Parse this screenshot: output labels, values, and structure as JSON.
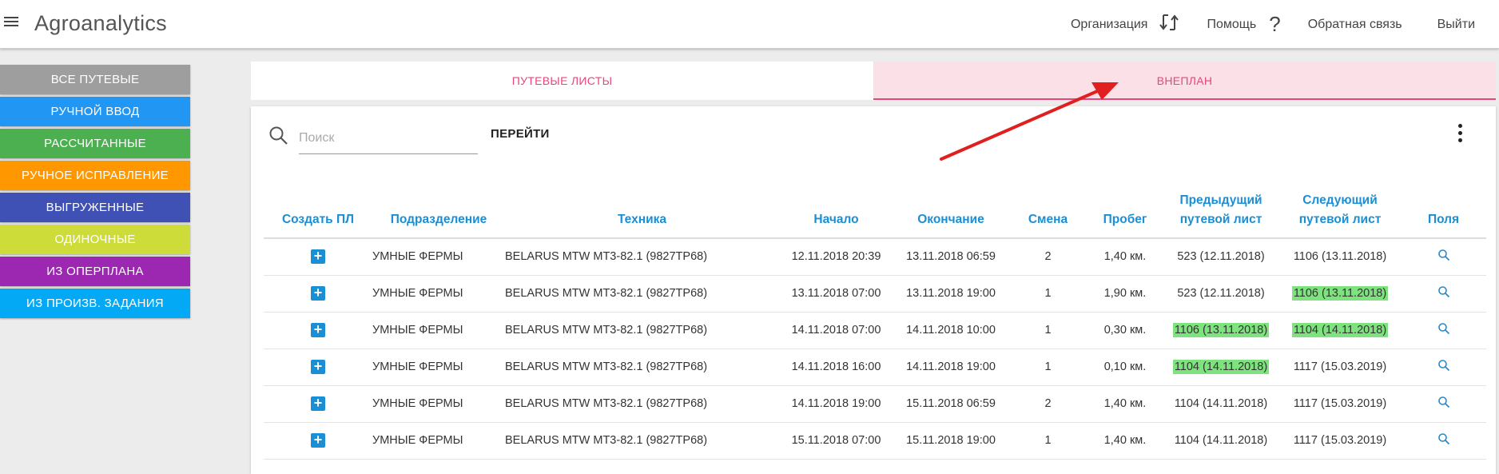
{
  "header": {
    "title": "Agroanalytics",
    "nav": {
      "organization": "Организация",
      "help": "Помощь",
      "feedback": "Обратная связь",
      "logout": "Выйти"
    }
  },
  "sidebar": {
    "items": [
      {
        "label": "ВСЕ ПУТЕВЫЕ",
        "color": "#9e9e9e"
      },
      {
        "label": "РУЧНОЙ ВВОД",
        "color": "#2196f3"
      },
      {
        "label": "РАССЧИТАННЫЕ",
        "color": "#4caf50"
      },
      {
        "label": "РУЧНОЕ ИСПРАВЛЕНИЕ",
        "color": "#ff9800"
      },
      {
        "label": "ВЫГРУЖЕННЫЕ",
        "color": "#3f51b5"
      },
      {
        "label": "ОДИНОЧНЫЕ",
        "color": "#cddc39"
      },
      {
        "label": "ИЗ ОПЕРПЛАНА",
        "color": "#9c27b0"
      },
      {
        "label": "ИЗ ПРОИЗВ. ЗАДАНИЯ",
        "color": "#03a9f4"
      }
    ]
  },
  "tabs": [
    {
      "label": "ПУТЕВЫЕ ЛИСТЫ",
      "active": false
    },
    {
      "label": "ВНЕПЛАН",
      "active": true
    }
  ],
  "search": {
    "placeholder": "Поиск",
    "go_label": "ПЕРЕЙТИ"
  },
  "table": {
    "headers": {
      "create": "Создать ПЛ",
      "division": "Подразделение",
      "vehicle": "Техника",
      "start": "Начало",
      "end": "Окончание",
      "shift": "Смена",
      "mileage": "Пробег",
      "prev_1": "Предыдущий",
      "prev_2": "путевой лист",
      "next_1": "Следующий",
      "next_2": "путевой лист",
      "fields": "Поля"
    },
    "rows": [
      {
        "division": "УМНЫЕ ФЕРМЫ",
        "vehicle": "BELARUS MTW MT3-82.1 (9827TP68)",
        "start": "12.11.2018 20:39",
        "end": "13.11.2018 06:59",
        "shift": "2",
        "mileage": "1,40 км.",
        "prev": "523 (12.11.2018)",
        "next": "1106 (13.11.2018)"
      },
      {
        "division": "УМНЫЕ ФЕРМЫ",
        "vehicle": "BELARUS MTW MT3-82.1 (9827TP68)",
        "start": "13.11.2018 07:00",
        "end": "13.11.2018 19:00",
        "shift": "1",
        "mileage": "1,90 км.",
        "prev": "523 (12.11.2018)",
        "next": "1106 (13.11.2018)"
      },
      {
        "division": "УМНЫЕ ФЕРМЫ",
        "vehicle": "BELARUS MTW MT3-82.1 (9827TP68)",
        "start": "14.11.2018 07:00",
        "end": "14.11.2018 10:00",
        "shift": "1",
        "mileage": "0,30 км.",
        "prev": "1106 (13.11.2018)",
        "next": "1104 (14.11.2018)"
      },
      {
        "division": "УМНЫЕ ФЕРМЫ",
        "vehicle": "BELARUS MTW MT3-82.1 (9827TP68)",
        "start": "14.11.2018 16:00",
        "end": "14.11.2018 19:00",
        "shift": "1",
        "mileage": "0,10 км.",
        "prev": "1104 (14.11.2018)",
        "next": "1117 (15.03.2019)"
      },
      {
        "division": "УМНЫЕ ФЕРМЫ",
        "vehicle": "BELARUS MTW MT3-82.1 (9827TP68)",
        "start": "14.11.2018 19:00",
        "end": "15.11.2018 06:59",
        "shift": "2",
        "mileage": "1,40 км.",
        "prev": "1104 (14.11.2018)",
        "next": "1117 (15.03.2019)"
      },
      {
        "division": "УМНЫЕ ФЕРМЫ",
        "vehicle": "BELARUS MTW MT3-82.1 (9827TP68)",
        "start": "15.11.2018 07:00",
        "end": "15.11.2018 19:00",
        "shift": "1",
        "mileage": "1,40 км.",
        "prev": "1104 (14.11.2018)",
        "next": "1117 (15.03.2019)"
      }
    ],
    "highlight_color": "#7ee37e"
  },
  "annotation_color": "#e02020"
}
